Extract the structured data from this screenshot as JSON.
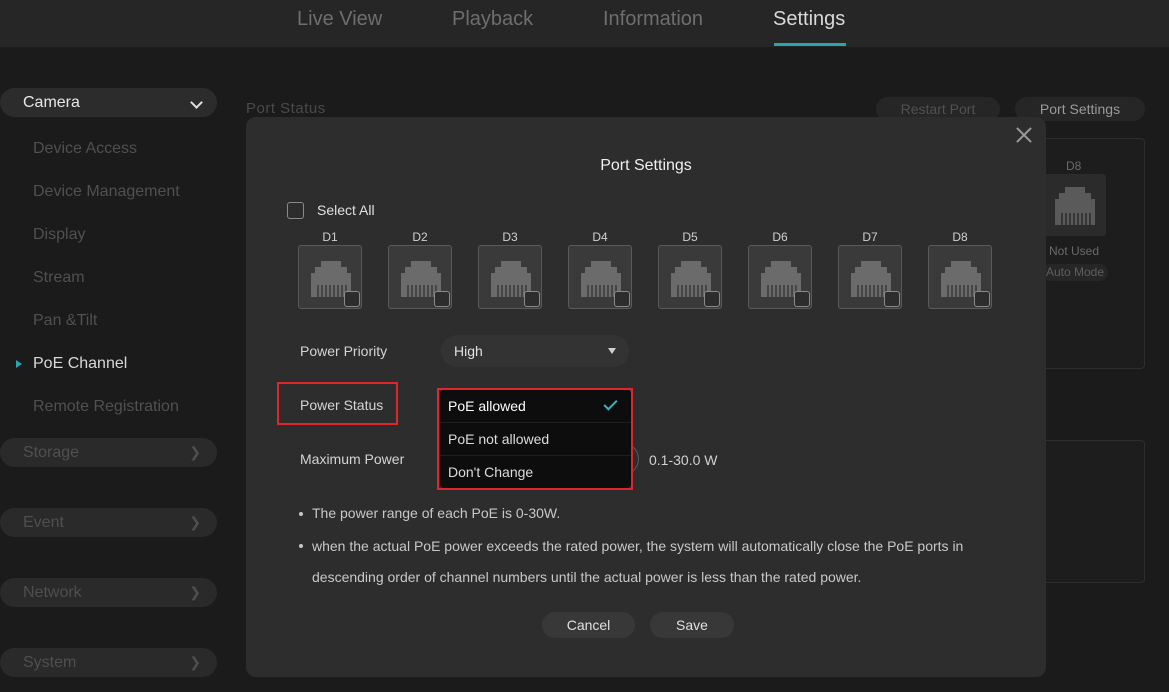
{
  "topnav": {
    "tabs": [
      {
        "label": "Live View"
      },
      {
        "label": "Playback"
      },
      {
        "label": "Information"
      },
      {
        "label": "Settings"
      }
    ],
    "active": "Settings",
    "accent_color": "#2ea3b0"
  },
  "sidebar": {
    "groups": {
      "camera": {
        "label": "Camera",
        "items": [
          {
            "label": "Device Access"
          },
          {
            "label": "Device Management"
          },
          {
            "label": "Display"
          },
          {
            "label": "Stream"
          },
          {
            "label": "Pan &Tilt"
          },
          {
            "label": "PoE Channel"
          },
          {
            "label": "Remote Registration"
          }
        ],
        "active_item": "PoE Channel"
      },
      "storage": {
        "label": "Storage"
      },
      "event": {
        "label": "Event"
      },
      "network": {
        "label": "Network"
      },
      "system": {
        "label": "System"
      }
    }
  },
  "background": {
    "section_title": "Port Status",
    "restart_label": "Restart Port",
    "port_settings_label": "Port Settings",
    "port_label": "D8",
    "port_status": "Not Used",
    "port_mode": "Auto Mode"
  },
  "modal": {
    "title": "Port Settings",
    "select_all_label": "Select All",
    "ports": [
      {
        "label": "D1"
      },
      {
        "label": "D2"
      },
      {
        "label": "D3"
      },
      {
        "label": "D4"
      },
      {
        "label": "D5"
      },
      {
        "label": "D6"
      },
      {
        "label": "D7"
      },
      {
        "label": "D8"
      }
    ],
    "power_priority": {
      "label": "Power Priority",
      "value": "High"
    },
    "power_status": {
      "label": "Power Status",
      "options": [
        {
          "label": "PoE allowed"
        },
        {
          "label": "PoE not allowed"
        },
        {
          "label": "Don't Change"
        }
      ],
      "selected": "PoE allowed"
    },
    "maximum_power": {
      "label": "Maximum Power",
      "range": "0.1-30.0 W"
    },
    "notes": [
      "The power range of each PoE is 0-30W.",
      "when the actual PoE power exceeds the rated power, the system will automatically close the PoE ports in",
      "descending order of channel numbers until the actual power is less than the rated power."
    ],
    "cancel_label": "Cancel",
    "save_label": "Save",
    "highlight_color": "#e0262b"
  }
}
